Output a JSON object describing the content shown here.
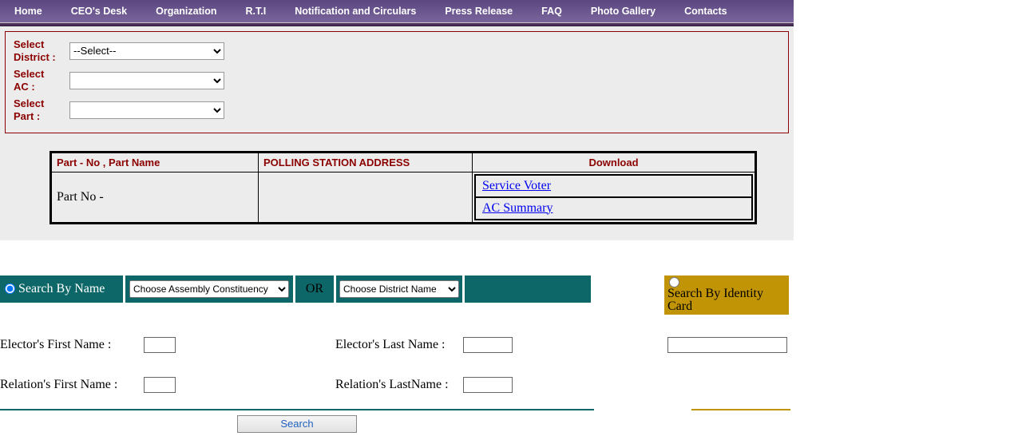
{
  "nav": {
    "items": [
      "Home",
      "CEO's Desk",
      "Organization",
      "R.T.I",
      "Notification and Circulars",
      "Press Release",
      "FAQ",
      "Photo Gallery",
      "Contacts"
    ]
  },
  "selectors": {
    "district_label_l1": "Select",
    "district_label_l2": "District :",
    "district_value": "--Select--",
    "ac_label_l1": "Select",
    "ac_label_l2": "AC :",
    "ac_value": "",
    "part_label_l1": "Select",
    "part_label_l2": "Part :",
    "part_value": ""
  },
  "poll_table": {
    "headers": {
      "col1": "Part - No , Part Name",
      "col2": "POLLING STATION ADDRESS",
      "col3": "Download"
    },
    "row": {
      "part": "Part No -",
      "address": ""
    },
    "downloads": {
      "service_voter": "Service Voter",
      "ac_summary": "AC Summary"
    }
  },
  "search": {
    "by_name_label": "Search By Name",
    "assembly_placeholder": "Choose Assembly Constituency",
    "or_label": "OR",
    "district_placeholder": "Choose District Name",
    "by_id_label": "Search By Identity Card",
    "elector_first": "Elector's First Name :",
    "elector_last": "Elector's Last Name :",
    "relation_first": "Relation's First Name :",
    "relation_last": "Relation's LastName :",
    "button": "Search"
  }
}
